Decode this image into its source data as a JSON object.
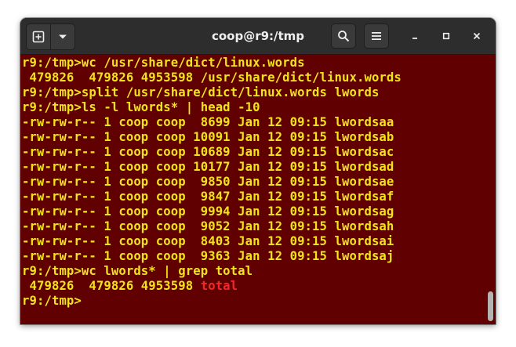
{
  "window": {
    "title": "coop@r9:/tmp"
  },
  "titlebar": {
    "new_tab_icon": "new-tab-icon",
    "menu_dropdown_icon": "chevron-down-icon",
    "search_icon": "search-icon",
    "hamburger_icon": "hamburger-menu-icon",
    "minimize_icon": "minimize-icon",
    "maximize_icon": "maximize-icon",
    "close_icon": "close-icon"
  },
  "colors": {
    "terminal_background": "#600000",
    "text_yellow": "#f2e31a",
    "text_red": "#ef2929",
    "titlebar": "#2d2d2d"
  },
  "terminal": {
    "lines": [
      {
        "text": "r9:/tmp>wc /usr/share/dict/linux.words"
      },
      {
        "text": " 479826  479826 4953598 /usr/share/dict/linux.words"
      },
      {
        "text": "r9:/tmp>split /usr/share/dict/linux.words lwords"
      },
      {
        "text": "r9:/tmp>ls -l lwords* | head -10"
      },
      {
        "text": "-rw-rw-r-- 1 coop coop  8699 Jan 12 09:15 lwordsaa"
      },
      {
        "text": "-rw-rw-r-- 1 coop coop 10091 Jan 12 09:15 lwordsab"
      },
      {
        "text": "-rw-rw-r-- 1 coop coop 10689 Jan 12 09:15 lwordsac"
      },
      {
        "text": "-rw-rw-r-- 1 coop coop 10177 Jan 12 09:15 lwordsad"
      },
      {
        "text": "-rw-rw-r-- 1 coop coop  9850 Jan 12 09:15 lwordsae"
      },
      {
        "text": "-rw-rw-r-- 1 coop coop  9847 Jan 12 09:15 lwordsaf"
      },
      {
        "text": "-rw-rw-r-- 1 coop coop  9994 Jan 12 09:15 lwordsag"
      },
      {
        "text": "-rw-rw-r-- 1 coop coop  9052 Jan 12 09:15 lwordsah"
      },
      {
        "text": "-rw-rw-r-- 1 coop coop  8403 Jan 12 09:15 lwordsai"
      },
      {
        "text": "-rw-rw-r-- 1 coop coop  9363 Jan 12 09:15 lwordsaj"
      },
      {
        "text": "r9:/tmp>wc lwords* | grep total"
      },
      {
        "text": " 479826  479826 4953598 ",
        "highlight": "total"
      },
      {
        "text": "r9:/tmp>"
      }
    ]
  }
}
